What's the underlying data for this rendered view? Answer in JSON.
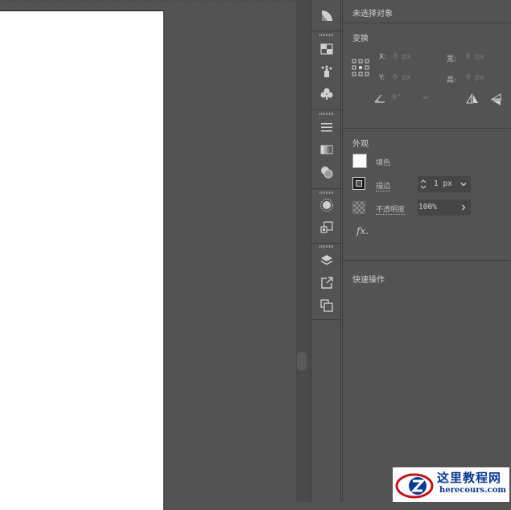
{
  "panel": {
    "header": "未选择对象",
    "transform": {
      "title": "变换",
      "x_label": "X:",
      "x_value": "0 px",
      "y_label": "Y:",
      "y_value": "0 px",
      "w_label": "宽:",
      "w_value": "0 px",
      "h_label": "高:",
      "h_value": "0 px",
      "angle_value": "0°"
    },
    "appearance": {
      "title": "外观",
      "fill_label": "填色",
      "stroke_label": "描边",
      "stroke_value": "1 px",
      "opacity_label": "不透明度",
      "opacity_value": "100%",
      "fx_label": "fx."
    },
    "quick_actions": {
      "title": "快速操作"
    }
  },
  "icons": [
    "pie-graph-icon",
    "swatch-grid-icon",
    "symbol-sprayer-icon",
    "club-symbol-icon",
    "align-lines-icon",
    "gradient-icon",
    "transparency-icon",
    "appearance-sun-icon",
    "image-trace-icon",
    "layers-icon",
    "export-icon",
    "artboards-icon"
  ],
  "watermark": {
    "title": "这里教程网",
    "url": "herecours.com"
  },
  "colors": {
    "panel_bg": "#535353",
    "artboard": "#ffffff",
    "watermark_text": "#0b3a8f",
    "watermark_logo": "#c0141b"
  }
}
